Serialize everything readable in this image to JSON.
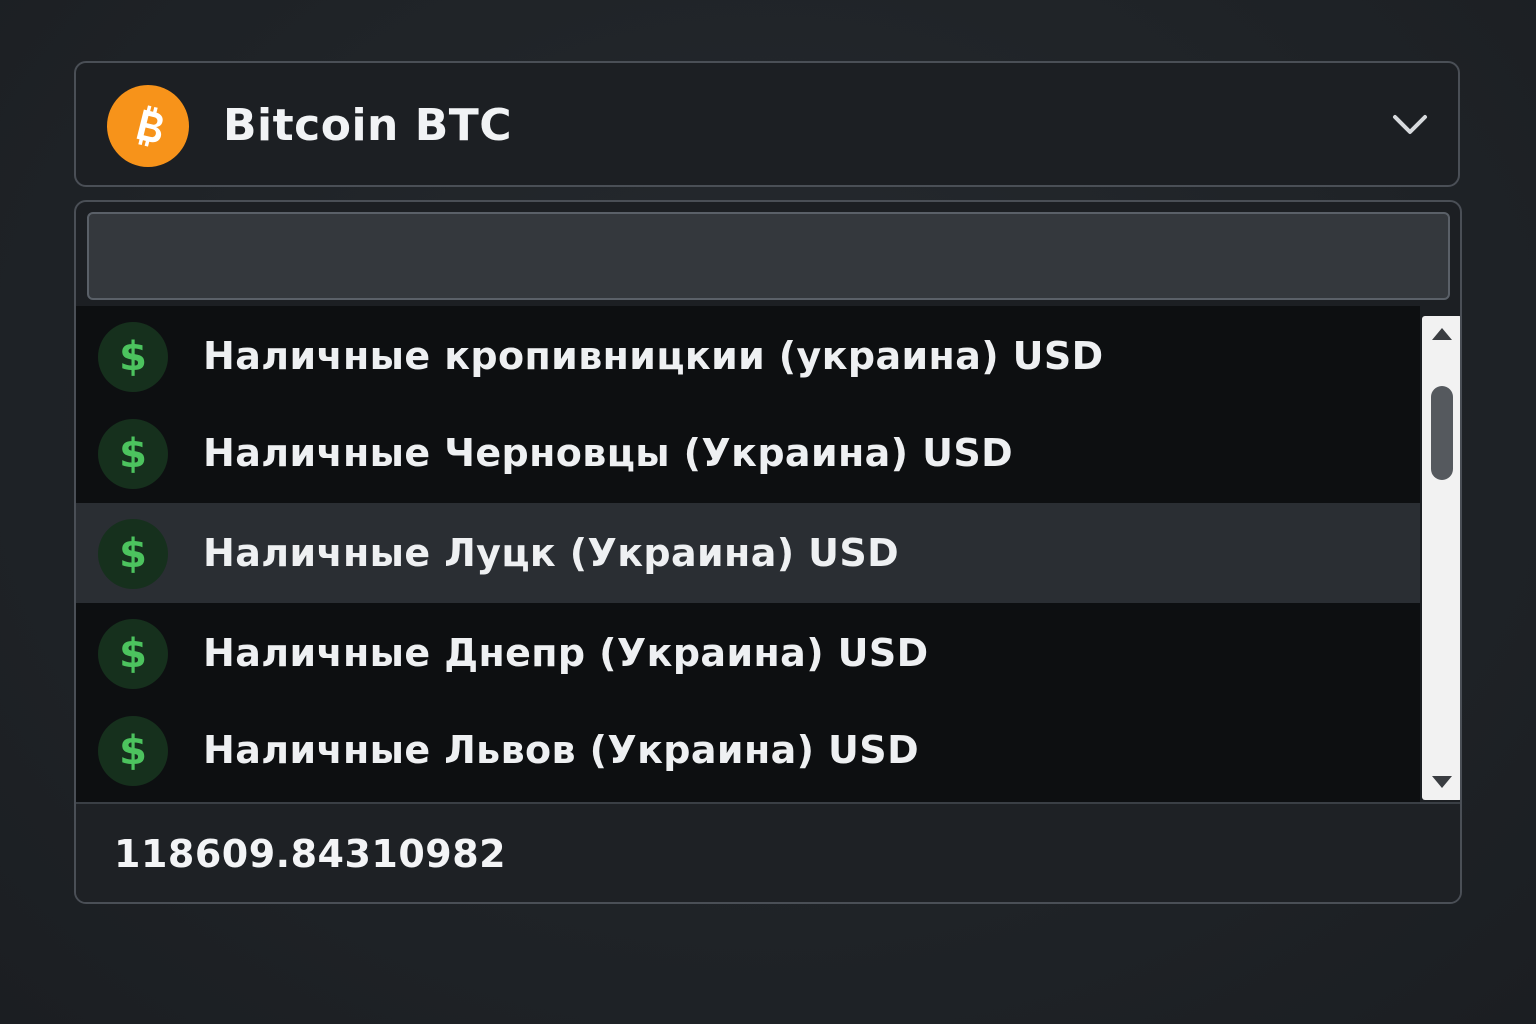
{
  "selector": {
    "currency_name": "Bitcoin BTC",
    "icon": "bitcoin-icon",
    "icon_color": "#f7931a"
  },
  "search": {
    "value": "",
    "placeholder": ""
  },
  "options": [
    {
      "label": "Наличные кропивницкии (украина) USD",
      "icon": "dollar-icon",
      "highlighted": false
    },
    {
      "label": "Наличные Черновцы (Украина) USD",
      "icon": "dollar-icon",
      "highlighted": false
    },
    {
      "label": "Наличные Луцк (Украина) USD",
      "icon": "dollar-icon",
      "highlighted": true
    },
    {
      "label": "Наличные Днепр (Украина) USD",
      "icon": "dollar-icon",
      "highlighted": false
    },
    {
      "label": "Наличные Львов (Украина) USD",
      "icon": "dollar-icon",
      "highlighted": false
    }
  ],
  "amount": {
    "value": "118609.84310982"
  },
  "colors": {
    "background": "#1f2327",
    "list_background": "#0d0f11",
    "highlight": "#2a2e33",
    "dollar_green": "#4cc35e"
  }
}
